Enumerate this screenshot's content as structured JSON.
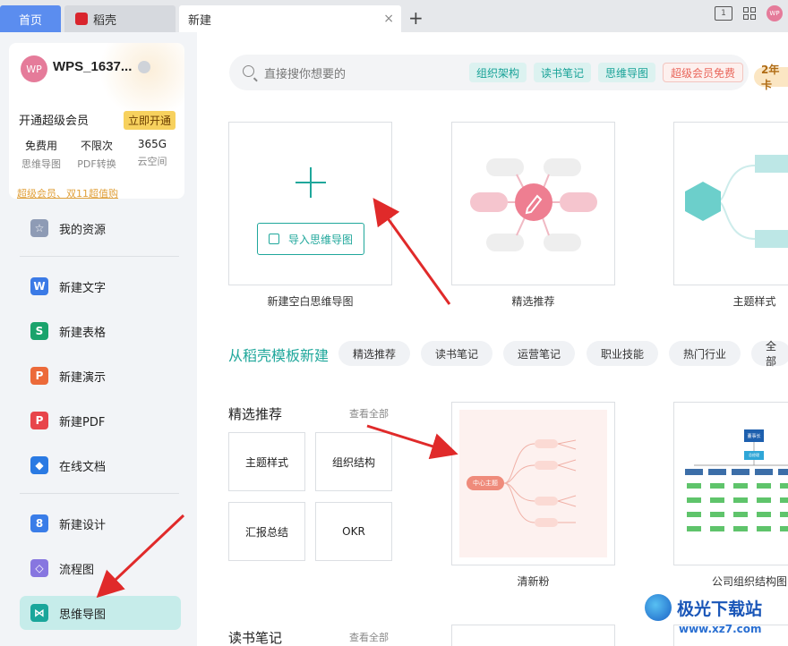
{
  "tabs": {
    "home": "首页",
    "daoke": "稻壳",
    "new": "新建",
    "close": "×",
    "add": "+"
  },
  "titlebar": {
    "avatar": "WP",
    "view_label": "1"
  },
  "user": {
    "avatar": "WP",
    "name": "WPS_1637...",
    "vip_label": "开通超级会员",
    "vip_button": "立即开通",
    "stats": [
      {
        "value": "免费用",
        "label": "思维导图"
      },
      {
        "value": "不限次",
        "label": "PDF转换"
      },
      {
        "value": "365G",
        "label": "云空间"
      }
    ],
    "promo": "超级会员、双11超值购"
  },
  "nav": [
    {
      "label": "我的资源",
      "color": "#8e9bb5",
      "glyph": "☆"
    },
    {
      "label": "新建文字",
      "color": "#3b7ae6",
      "glyph": "W"
    },
    {
      "label": "新建表格",
      "color": "#1aa36c",
      "glyph": "S"
    },
    {
      "label": "新建演示",
      "color": "#ec6a3a",
      "glyph": "P"
    },
    {
      "label": "新建PDF",
      "color": "#e8454b",
      "glyph": "P"
    },
    {
      "label": "在线文档",
      "color": "#2a7ae3",
      "glyph": "◆"
    },
    {
      "label": "新建设计",
      "color": "#3a7de8",
      "glyph": "8"
    },
    {
      "label": "流程图",
      "color": "#8776e0",
      "glyph": "◇"
    },
    {
      "label": "思维导图",
      "color": "#1aa69b",
      "glyph": "⋈"
    }
  ],
  "search": {
    "placeholder": "直接搜你想要的",
    "chips": [
      "组织架构",
      "读书笔记",
      "思维导图"
    ],
    "vip_chip": "超级会员免费",
    "promo": "2年卡"
  },
  "top_cards": [
    {
      "caption": "新建空白思维导图",
      "button": "导入思维导图"
    },
    {
      "caption": "精选推荐"
    },
    {
      "caption": "主题样式"
    }
  ],
  "template_section": {
    "title": "从稻壳模板新建",
    "pills": [
      "精选推荐",
      "读书笔记",
      "运营笔记",
      "职业技能",
      "热门行业",
      "全部"
    ]
  },
  "featured": {
    "title": "精选推荐",
    "more": "查看全部",
    "items": [
      "主题样式",
      "组织结构",
      "汇报总结",
      "OKR"
    ],
    "templates": [
      {
        "caption": "清新粉",
        "center": "中心主题"
      },
      {
        "caption": "公司组织结构图",
        "root": "董事长",
        "sub": "总经理"
      }
    ]
  },
  "reading": {
    "title": "读书笔记",
    "more": "查看全部"
  },
  "watermark": {
    "name": "极光下载站",
    "url": "www.xz7.com"
  }
}
